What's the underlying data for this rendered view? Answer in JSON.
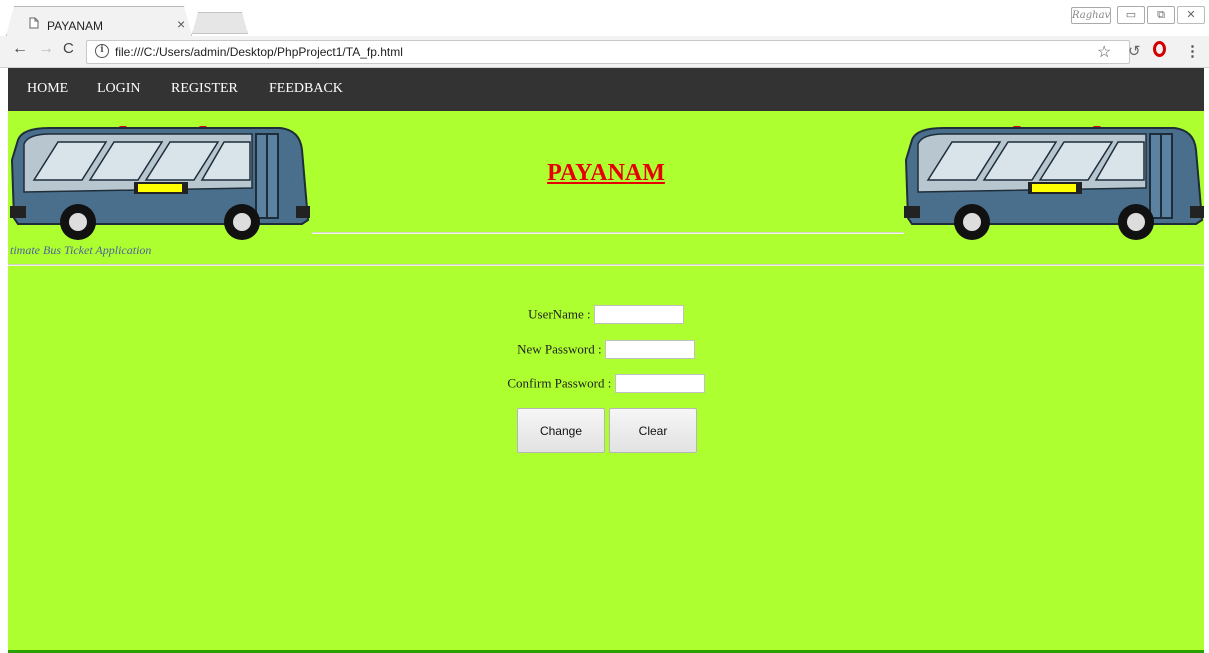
{
  "browser": {
    "tab_title": "PAYANAM",
    "tab_close": "×",
    "url": "file:///C:/Users/admin/Desktop/PhpProject1/TA_fp.html",
    "user_name": "Raghav",
    "icons": [
      "back-icon",
      "forward-icon",
      "reload-icon",
      "info-icon",
      "star-icon",
      "history-icon",
      "opera-icon",
      "menu-icon"
    ]
  },
  "nav": {
    "items": [
      "HOME",
      "LOGIN",
      "REGISTER",
      "FEEDBACK"
    ]
  },
  "header": {
    "title": "PAYANAM",
    "tagline": "timate Bus Ticket Application"
  },
  "form": {
    "username_label": "UserName :",
    "new_password_label": "New Password :",
    "confirm_password_label": "Confirm Password :",
    "username_value": "",
    "new_password_value": "",
    "confirm_password_value": "",
    "change_button": "Change",
    "clear_button": "Clear"
  },
  "colors": {
    "page_background": "#adff2f",
    "navbar_background": "#333333",
    "title_color": "#e60000",
    "bus_body": "#4a6f8c"
  }
}
